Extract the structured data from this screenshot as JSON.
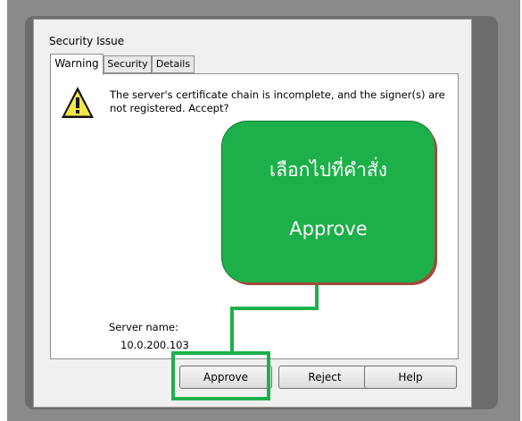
{
  "dialog": {
    "title": "Security Issue",
    "tabs": [
      {
        "label": "Warning",
        "active": true
      },
      {
        "label": "Security",
        "active": false
      },
      {
        "label": "Details",
        "active": false
      }
    ],
    "message": "The server's certificate chain is incomplete, and the signer(s) are not registered. Accept?",
    "server_name_label": "Server name:",
    "server_name_value": "10.0.200.103",
    "buttons": {
      "approve": "Approve",
      "reject": "Reject",
      "help": "Help"
    }
  },
  "annotation": {
    "line1": "เลือกไปที่คำสั่ง",
    "line2": "Approve",
    "color": "#1db04a"
  },
  "icons": {
    "warning": "warning-triangle-icon"
  }
}
